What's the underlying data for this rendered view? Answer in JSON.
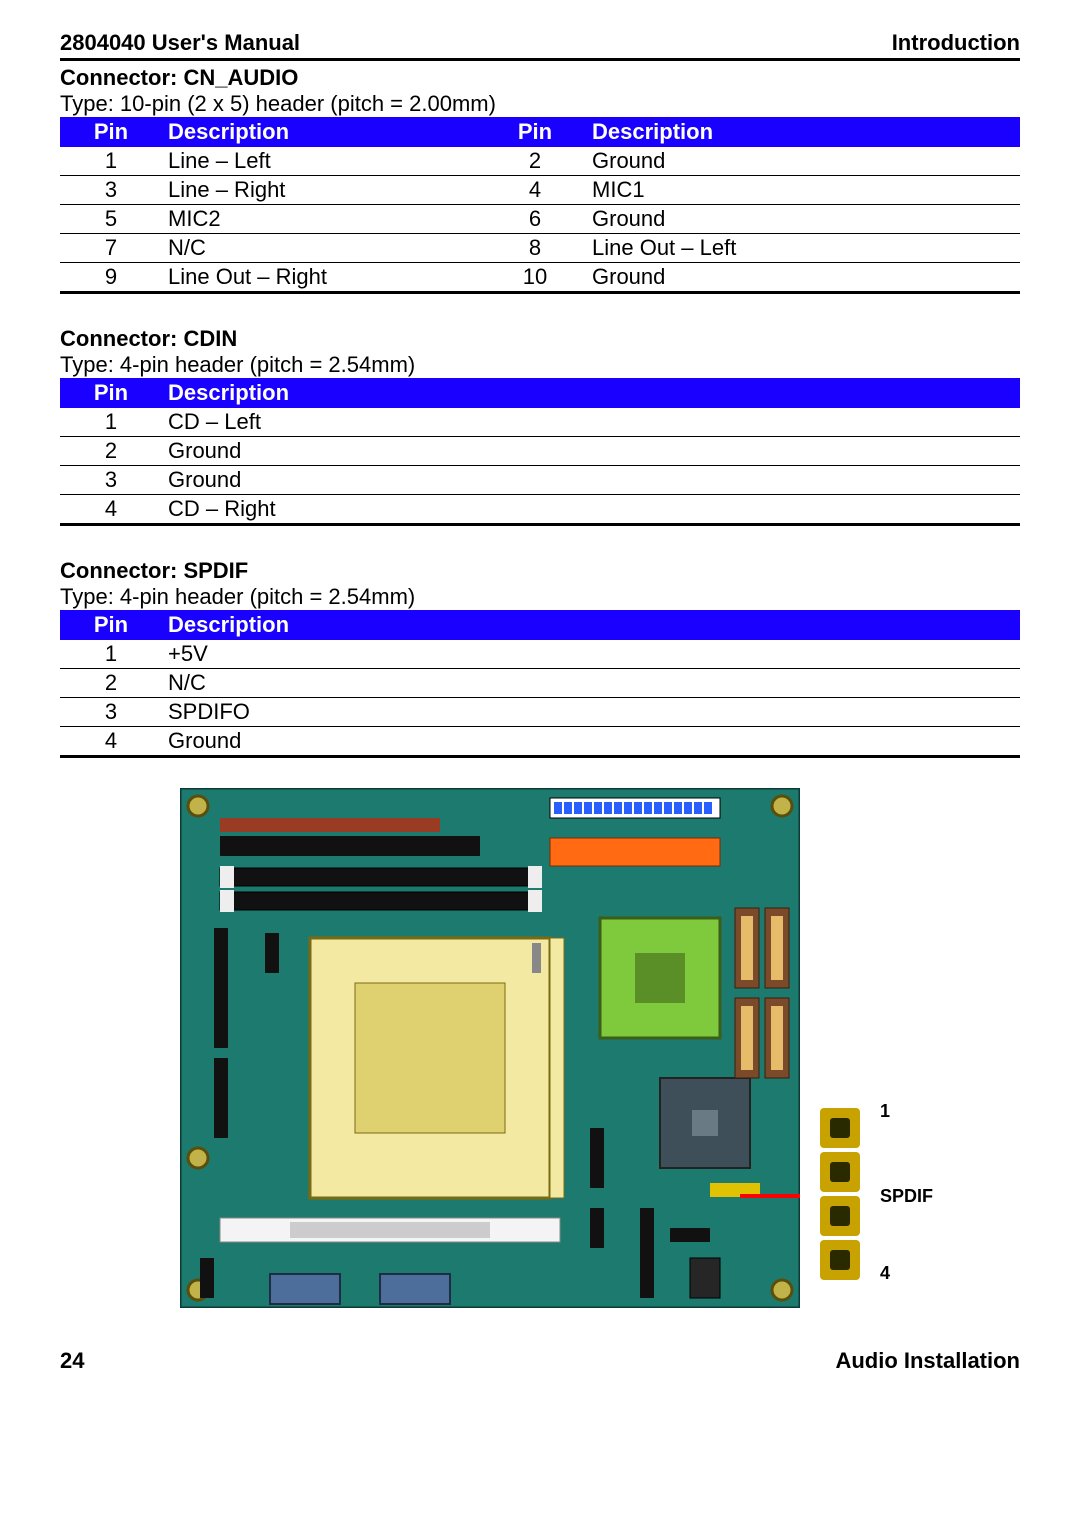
{
  "header": {
    "left": "2804040 User's Manual",
    "right": "Introduction"
  },
  "footer": {
    "left": "24",
    "right": "Audio  Installation"
  },
  "connectors": [
    {
      "name": "Connector: CN_AUDIO",
      "type": "Type: 10-pin (2 x 5) header (pitch = 2.00mm)",
      "cols": 4,
      "headers": [
        "Pin",
        "Description",
        "Pin",
        "Description"
      ],
      "rows": [
        [
          "1",
          "Line – Left",
          "2",
          "Ground"
        ],
        [
          "3",
          "Line – Right",
          "4",
          "MIC1"
        ],
        [
          "5",
          "MIC2",
          "6",
          "Ground"
        ],
        [
          "7",
          "N/C",
          "8",
          "Line Out – Left"
        ],
        [
          "9",
          "Line Out – Right",
          "10",
          "Ground"
        ]
      ]
    },
    {
      "name": "Connector: CDIN",
      "type": "Type: 4-pin header (pitch = 2.54mm)",
      "cols": 2,
      "headers": [
        "Pin",
        "Description"
      ],
      "rows": [
        [
          "1",
          "CD – Left"
        ],
        [
          "2",
          "Ground"
        ],
        [
          "3",
          "Ground"
        ],
        [
          "4",
          "CD – Right"
        ]
      ]
    },
    {
      "name": "Connector: SPDIF",
      "type": "Type: 4-pin header (pitch = 2.54mm)",
      "cols": 2,
      "headers": [
        "Pin",
        "Description"
      ],
      "rows": [
        [
          "1",
          "+5V"
        ],
        [
          "2",
          "N/C"
        ],
        [
          "3",
          "SPDIFO"
        ],
        [
          "4",
          "Ground"
        ]
      ]
    }
  ],
  "diagram": {
    "label1": "1",
    "label4": "4",
    "spdif": "SPDIF"
  }
}
